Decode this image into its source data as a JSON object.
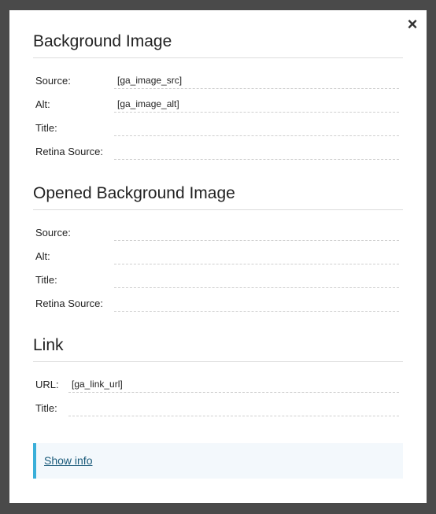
{
  "close_label": "×",
  "background_image": {
    "title": "Background Image",
    "fields": [
      {
        "label": "Source:",
        "value": "[ga_image_src]"
      },
      {
        "label": "Alt:",
        "value": "[ga_image_alt]"
      },
      {
        "label": "Title:",
        "value": ""
      },
      {
        "label": "Retina Source:",
        "value": ""
      }
    ]
  },
  "opened_background_image": {
    "title": "Opened Background Image",
    "fields": [
      {
        "label": "Source:",
        "value": ""
      },
      {
        "label": "Alt:",
        "value": ""
      },
      {
        "label": "Title:",
        "value": ""
      },
      {
        "label": "Retina Source:",
        "value": ""
      }
    ]
  },
  "link": {
    "title": "Link",
    "fields": [
      {
        "label": "URL:",
        "value": "[ga_link_url]"
      },
      {
        "label": "Title:",
        "value": ""
      }
    ]
  },
  "info": {
    "link_label": "Show info"
  },
  "colors": {
    "overlay": "#4a4a4a",
    "info_accent": "#3aafd9",
    "info_background": "#f3f8fc",
    "link": "#1a5a7a"
  }
}
